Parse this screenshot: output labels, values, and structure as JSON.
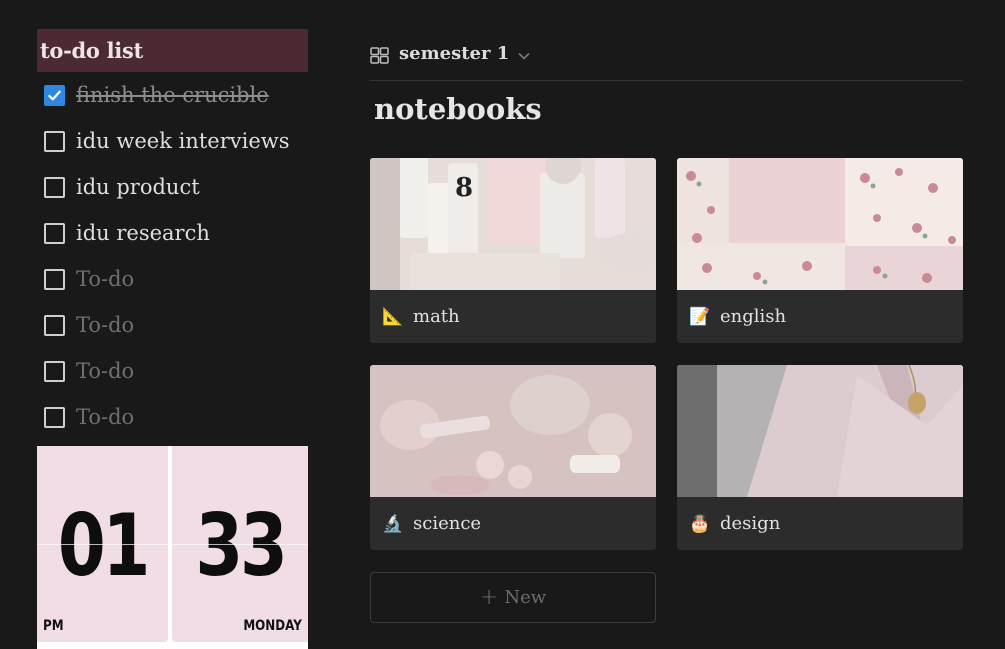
{
  "todo": {
    "title": "to-do list",
    "items": [
      {
        "label": "finish the crucible",
        "checked": true
      },
      {
        "label": "idu week interviews",
        "checked": false
      },
      {
        "label": "idu product",
        "checked": false
      },
      {
        "label": "idu research",
        "checked": false
      },
      {
        "label": "To-do",
        "checked": false,
        "placeholder": true
      },
      {
        "label": "To-do",
        "checked": false,
        "placeholder": true
      },
      {
        "label": "To-do",
        "checked": false,
        "placeholder": true
      },
      {
        "label": "To-do",
        "checked": false,
        "placeholder": true
      }
    ]
  },
  "clock": {
    "hour": "01",
    "minute": "33",
    "period": "PM",
    "day": "MONDAY"
  },
  "view": {
    "label": "semester 1",
    "icon": "gallery-view-icon"
  },
  "section": {
    "title": "notebooks"
  },
  "cards": [
    {
      "label": "math",
      "emoji": "📐",
      "icon": "triangular-ruler-icon"
    },
    {
      "label": "english",
      "emoji": "📝",
      "icon": "memo-icon"
    },
    {
      "label": "science",
      "emoji": "🔬",
      "icon": "microscope-icon"
    },
    {
      "label": "design",
      "emoji": "🎂",
      "icon": "cake-icon"
    }
  ],
  "new_button": {
    "label": "New"
  },
  "colors": {
    "background": "#191919",
    "todo_header": "#4b2a34",
    "checkbox_checked": "#2e87e0",
    "clock_panel": "#f0dde6"
  }
}
